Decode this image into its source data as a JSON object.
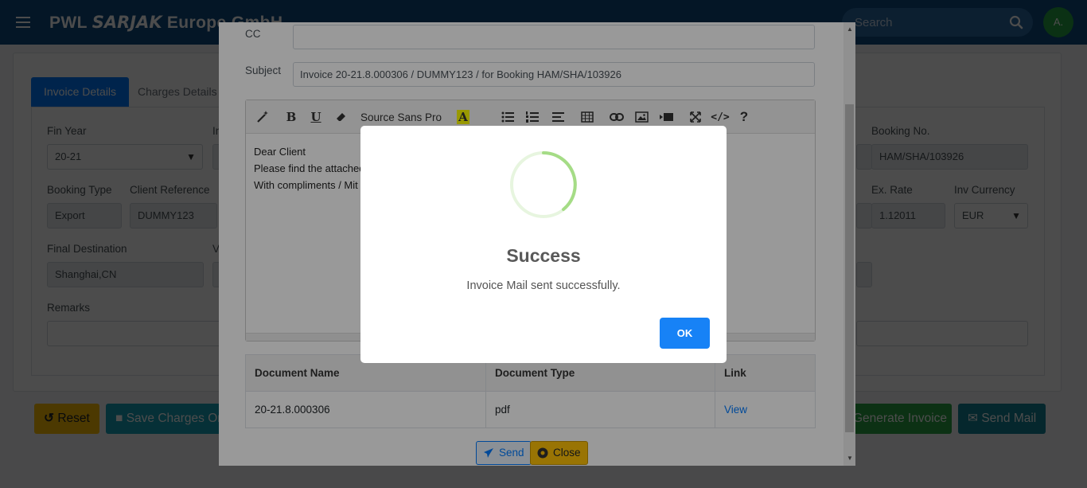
{
  "navbar": {
    "brand_prefix": "PWL",
    "brand_mark": "SARJAK",
    "brand_suffix": "Europe GmbH",
    "search_placeholder": "Search",
    "avatar_initial": "A."
  },
  "tabs": [
    "Invoice Details",
    "Charges Details"
  ],
  "form": {
    "fin_year_label": "Fin Year",
    "fin_year_value": "20-21",
    "booking_no_label": "Booking No.",
    "booking_no_value": "HAM/SHA/103926",
    "booking_type_label": "Booking Type",
    "booking_type_value": "Export",
    "client_ref_label": "Client Reference",
    "client_ref_value": "DUMMY123",
    "ex_rate_label": "Ex. Rate",
    "ex_rate_value": "1.12011",
    "inv_currency_label": "Inv Currency",
    "inv_currency_value": "EUR",
    "final_dest_label": "Final Destination",
    "final_dest_value": "Shanghai,CN",
    "remarks_label": "Remarks",
    "trunc_in": "In",
    "trunc_ve": "Ve"
  },
  "actions": {
    "reset": "Reset",
    "save_charges": "Save Charges Or",
    "generate_invoice": "Generate Invoice",
    "send_mail": "Send Mail"
  },
  "mail_modal": {
    "cc_label": "CC",
    "cc_value": "",
    "subject_label": "Subject",
    "subject_value": "Invoice 20-21.8.000306 / DUMMY123 / for Booking HAM/SHA/103926",
    "font_name": "Source Sans Pro",
    "body_line1": "Dear Client",
    "body_line2": "Please find the attached invoice 20-21.8.000306 for your reference. DUMMY123 Thank you.",
    "body_line3": "With compliments / Mit freundlichen Grüßen",
    "table_headers": [
      "Document Name",
      "Document Type",
      "Link"
    ],
    "table_row": {
      "name": "20-21.8.000306",
      "type": "pdf",
      "link": "View"
    },
    "send_label": "Send",
    "close_label": "Close"
  },
  "alert": {
    "title": "Success",
    "message": "Invoice Mail sent successfully.",
    "ok_label": "OK"
  },
  "colors": {
    "navbar": "#0f4c81",
    "primary": "#007bff",
    "success": "#28a745",
    "warning": "#ffc107",
    "info": "#17a2b8"
  }
}
